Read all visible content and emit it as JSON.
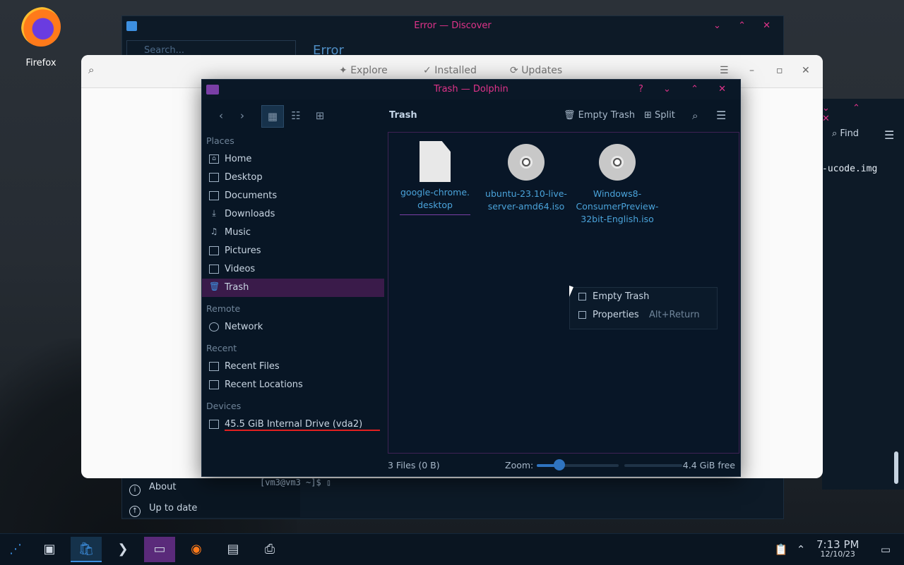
{
  "desktop": {
    "icon_label": "Firefox"
  },
  "discover": {
    "title": "Error — Discover",
    "search_placeholder": "Search...",
    "heading": "Error",
    "about": "About",
    "up_to_date": "Up to date",
    "window_buttons": "⌄ ⌃ ✕"
  },
  "terminal_bg": {
    "prompt": "[vm3@vm3 ~]$ ",
    "find": "Find",
    "text_fragment": "-ucode.img",
    "window_buttons": "⌄ ⌃ ✕"
  },
  "gnome_software": {
    "tabs": [
      "Explore",
      "Installed",
      "Updates"
    ]
  },
  "dolphin": {
    "title": "Trash — Dolphin",
    "window_buttons": "? ⌄ ⌃ ✕",
    "breadcrumb": "Trash",
    "empty_trash": "Empty Trash",
    "split": "Split",
    "places": {
      "header": "Places",
      "items": [
        "Home",
        "Desktop",
        "Documents",
        "Downloads",
        "Music",
        "Pictures",
        "Videos",
        "Trash"
      ]
    },
    "remote": {
      "header": "Remote",
      "items": [
        "Network"
      ]
    },
    "recent": {
      "header": "Recent",
      "items": [
        "Recent Files",
        "Recent Locations"
      ]
    },
    "devices": {
      "header": "Devices",
      "items": [
        "45.5 GiB Internal Drive (vda2)"
      ]
    },
    "files": [
      {
        "name": "google-chrome.\ndesktop",
        "line1": "google-chrome.",
        "line2": "desktop",
        "line3": "",
        "icon": "document-icon"
      },
      {
        "name": "ubuntu-23.10-live-server-amd64.iso",
        "line1": "ubuntu-23.10-live-",
        "line2": "server-amd64.iso",
        "line3": "",
        "icon": "disc-icon"
      },
      {
        "name": "Windows8-ConsumerPreview-32bit-English.iso",
        "line1": "Windows8-",
        "line2": "ConsumerPreview-",
        "line3": "32bit-English.iso",
        "icon": "disc-icon"
      }
    ],
    "context_menu": [
      {
        "label": "Empty Trash",
        "shortcut": ""
      },
      {
        "label": "Properties",
        "shortcut": "Alt+Return"
      }
    ],
    "status": {
      "count": "3 Files (0 B)",
      "zoom_label": "Zoom:",
      "zoom_level": 0.28,
      "free": "4.4 GiB free"
    },
    "accent": "#e0338a"
  },
  "taskbar": {
    "time": "7:13 PM",
    "date": "12/10/23"
  }
}
